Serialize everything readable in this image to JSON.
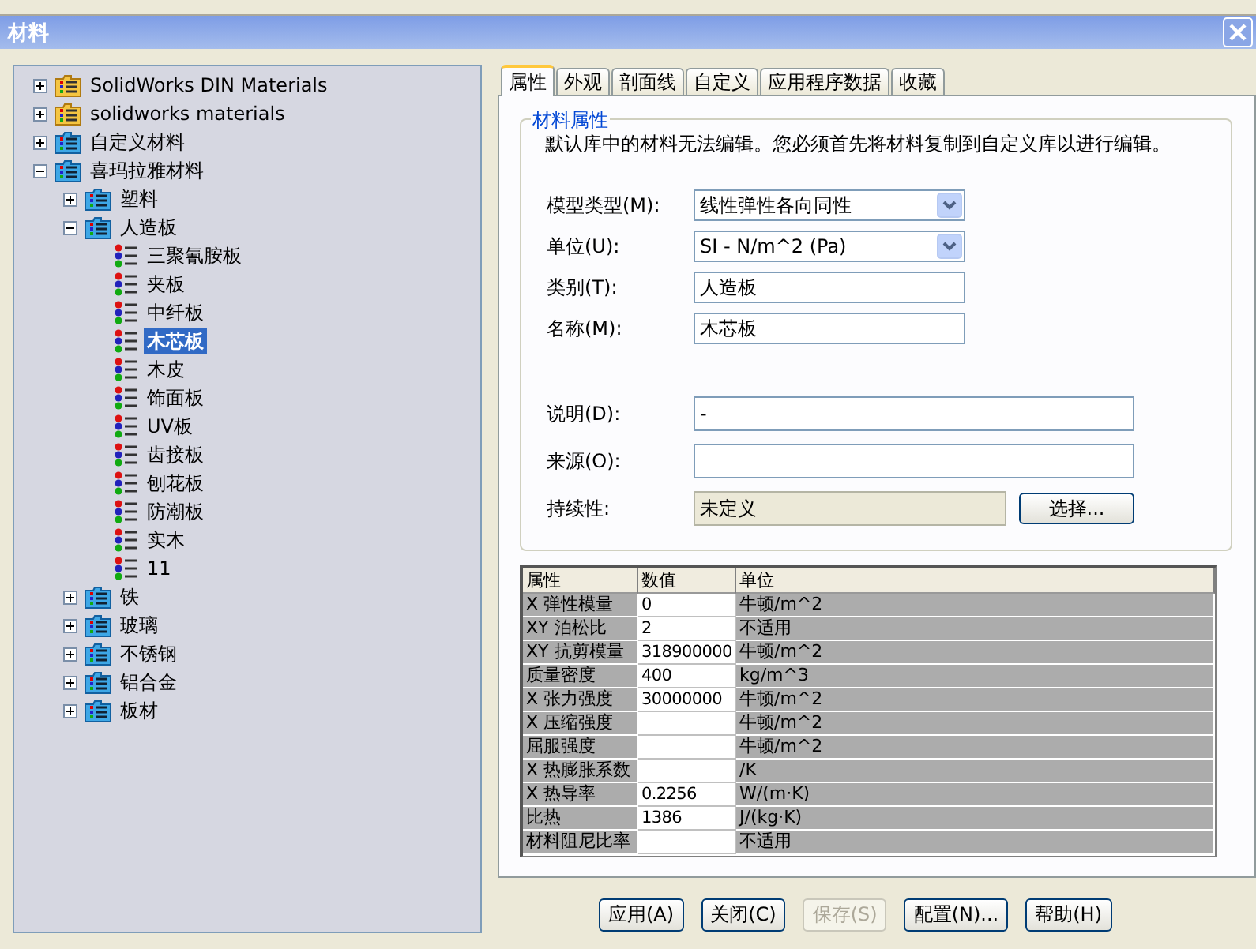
{
  "window": {
    "title": "材料"
  },
  "tree": [
    {
      "label": "SolidWorks DIN Materials",
      "kind": "library",
      "expanded": false,
      "selected": false
    },
    {
      "label": "solidworks materials",
      "kind": "library",
      "expanded": false,
      "selected": false
    },
    {
      "label": "自定义材料",
      "kind": "folder",
      "expanded": false,
      "selected": false
    },
    {
      "label": "喜玛拉雅材料",
      "kind": "folder",
      "expanded": true,
      "selected": false,
      "children": [
        {
          "label": "塑料",
          "kind": "folder",
          "expanded": false,
          "selected": false
        },
        {
          "label": "人造板",
          "kind": "folder",
          "expanded": true,
          "selected": false,
          "children": [
            {
              "label": "三聚氰胺板",
              "kind": "material",
              "selected": false
            },
            {
              "label": "夹板",
              "kind": "material",
              "selected": false
            },
            {
              "label": "中纤板",
              "kind": "material",
              "selected": false
            },
            {
              "label": "木芯板",
              "kind": "material",
              "selected": true
            },
            {
              "label": "木皮",
              "kind": "material",
              "selected": false
            },
            {
              "label": "饰面板",
              "kind": "material",
              "selected": false
            },
            {
              "label": "UV板",
              "kind": "material",
              "selected": false
            },
            {
              "label": "齿接板",
              "kind": "material",
              "selected": false
            },
            {
              "label": "刨花板",
              "kind": "material",
              "selected": false
            },
            {
              "label": "防潮板",
              "kind": "material",
              "selected": false
            },
            {
              "label": "实木",
              "kind": "material",
              "selected": false
            },
            {
              "label": "11",
              "kind": "material",
              "selected": false
            }
          ]
        },
        {
          "label": "铁",
          "kind": "folder",
          "expanded": false,
          "selected": false
        },
        {
          "label": "玻璃",
          "kind": "folder",
          "expanded": false,
          "selected": false
        },
        {
          "label": "不锈钢",
          "kind": "folder",
          "expanded": false,
          "selected": false
        },
        {
          "label": "铝合金",
          "kind": "folder",
          "expanded": false,
          "selected": false
        },
        {
          "label": "板材",
          "kind": "folder",
          "expanded": false,
          "selected": false
        }
      ]
    }
  ],
  "tabs": [
    {
      "label": "属性",
      "selected": true
    },
    {
      "label": "外观",
      "selected": false
    },
    {
      "label": "剖面线",
      "selected": false
    },
    {
      "label": "自定义",
      "selected": false
    },
    {
      "label": "应用程序数据",
      "selected": false
    },
    {
      "label": "收藏",
      "selected": false
    }
  ],
  "group": {
    "title": "材料属性",
    "note": "默认库中的材料无法编辑。您必须首先将材料复制到自定义库以进行编辑。"
  },
  "fields": [
    {
      "label": "模型类型(M):",
      "kind": "dropdown",
      "value": "线性弹性各向同性"
    },
    {
      "label": "单位(U):",
      "kind": "dropdown",
      "value": "SI - N/m^2 (Pa)"
    },
    {
      "label": "类别(T):",
      "kind": "text",
      "value": "人造板"
    },
    {
      "label": "名称(M):",
      "kind": "text",
      "value": "木芯板"
    }
  ],
  "details": [
    {
      "label": "说明(D):",
      "kind": "text",
      "value": "-"
    },
    {
      "label": "来源(O):",
      "kind": "text"
    },
    {
      "label": "持续性:",
      "kind": "readonly",
      "value": "未定义",
      "button": "选择..."
    }
  ],
  "grid": {
    "columns": [
      "属性",
      "数值",
      "单位"
    ],
    "rows": [
      {
        "property": "X 弹性模量",
        "value": "0",
        "unit": "牛顿/m^2"
      },
      {
        "property": "XY 泊松比",
        "value": "2",
        "unit": "不适用"
      },
      {
        "property": "XY 抗剪模量",
        "value": "318900000",
        "unit": "牛顿/m^2"
      },
      {
        "property": "质量密度",
        "value": "400",
        "unit": "kg/m^3"
      },
      {
        "property": "X 张力强度",
        "value": "30000000",
        "unit": "牛顿/m^2"
      },
      {
        "property": "X 压缩强度",
        "unit": "牛顿/m^2"
      },
      {
        "property": "屈服强度",
        "unit": "牛顿/m^2"
      },
      {
        "property": "X 热膨胀系数",
        "unit": "/K"
      },
      {
        "property": "X 热导率",
        "value": "0.2256",
        "unit": "W/(m·K)"
      },
      {
        "property": "比热",
        "value": "1386",
        "unit": "J/(kg·K)"
      },
      {
        "property": "材料阻尼比率",
        "unit": "不适用"
      }
    ]
  },
  "buttons": [
    {
      "label": "应用(A)",
      "disabled": false
    },
    {
      "label": "关闭(C)",
      "disabled": false
    },
    {
      "label": "保存(S)",
      "disabled": true
    },
    {
      "label": "配置(N)...",
      "disabled": false
    },
    {
      "label": "帮助(H)",
      "disabled": false
    }
  ]
}
